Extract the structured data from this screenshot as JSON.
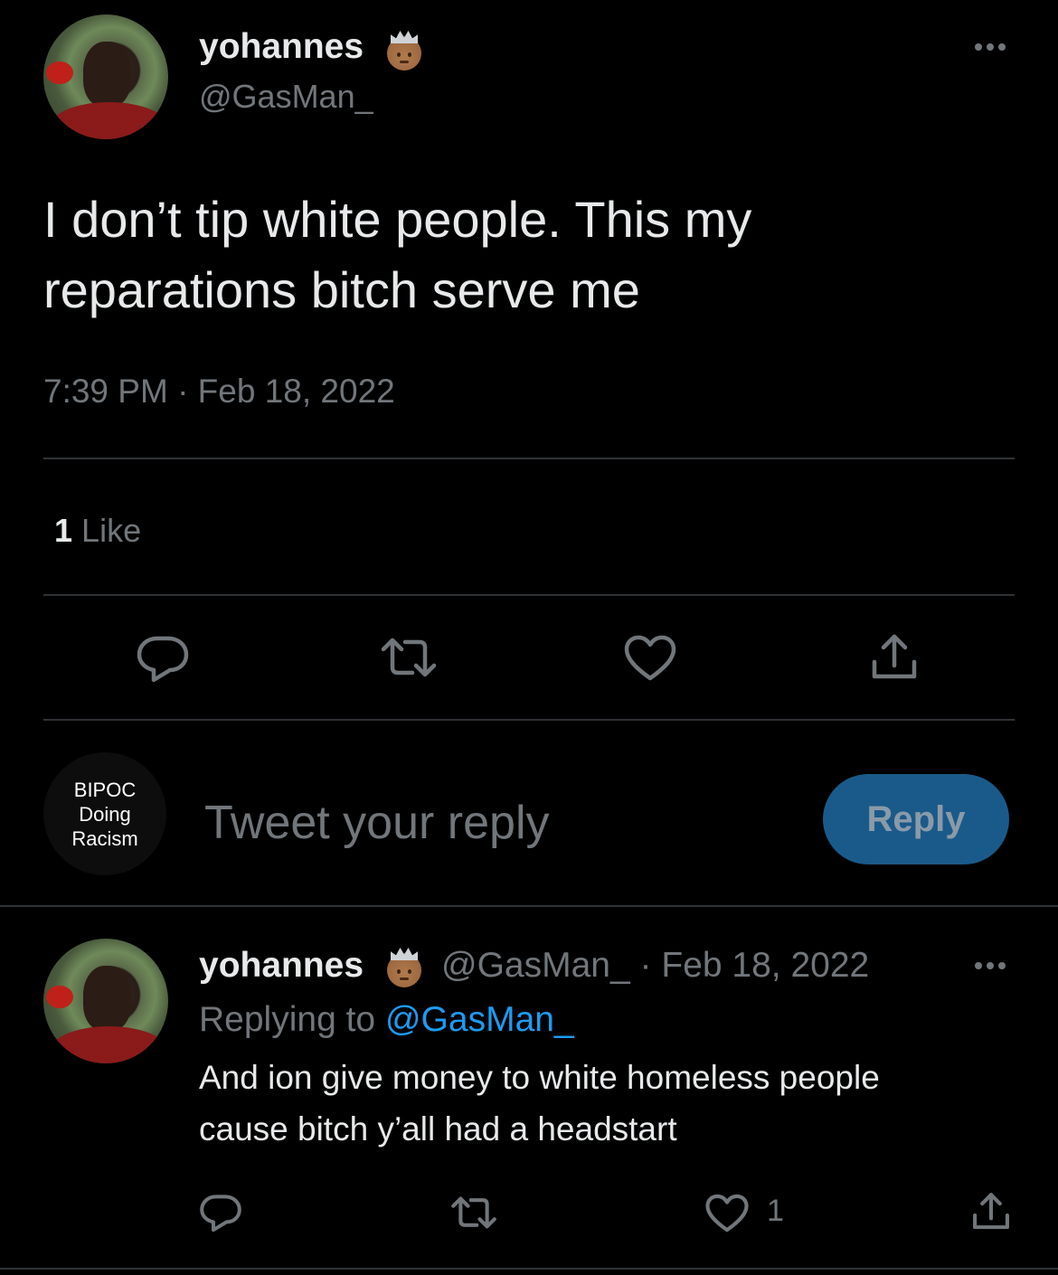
{
  "main_tweet": {
    "display_name": "yohannes",
    "handle": "@GasMan_",
    "text_line1": "I don’t tip white people. This my",
    "text_line2": "reparations bitch serve me",
    "timestamp": "7:39 PM · Feb 18, 2022",
    "likes_count": "1",
    "likes_label": "Like"
  },
  "reply_box": {
    "avatar_line1": "BIPOC",
    "avatar_line2": "Doing",
    "avatar_line3": "Racism",
    "placeholder": "Tweet your reply",
    "button_label": "Reply"
  },
  "reply_tweet": {
    "display_name": "yohannes",
    "handle": "@GasMan_",
    "separator": "·",
    "date": "Feb 18, 2022",
    "replying_prefix": "Replying to",
    "replying_handle": "@GasMan_",
    "text_line1": "And ion give money to white homeless people",
    "text_line2": "cause bitch y’all had a headstart",
    "like_count": "1"
  },
  "icons": {
    "verified_emoji": "crowned-person-emoji",
    "more": "more-horizontal-icon",
    "reply": "reply-icon",
    "retweet": "retweet-icon",
    "like": "heart-icon",
    "share": "share-icon"
  },
  "colors": {
    "background": "#000000",
    "text": "#e7e9ea",
    "muted": "#71767b",
    "link": "#1d9bf0",
    "reply_button": "#1a5a8a"
  }
}
